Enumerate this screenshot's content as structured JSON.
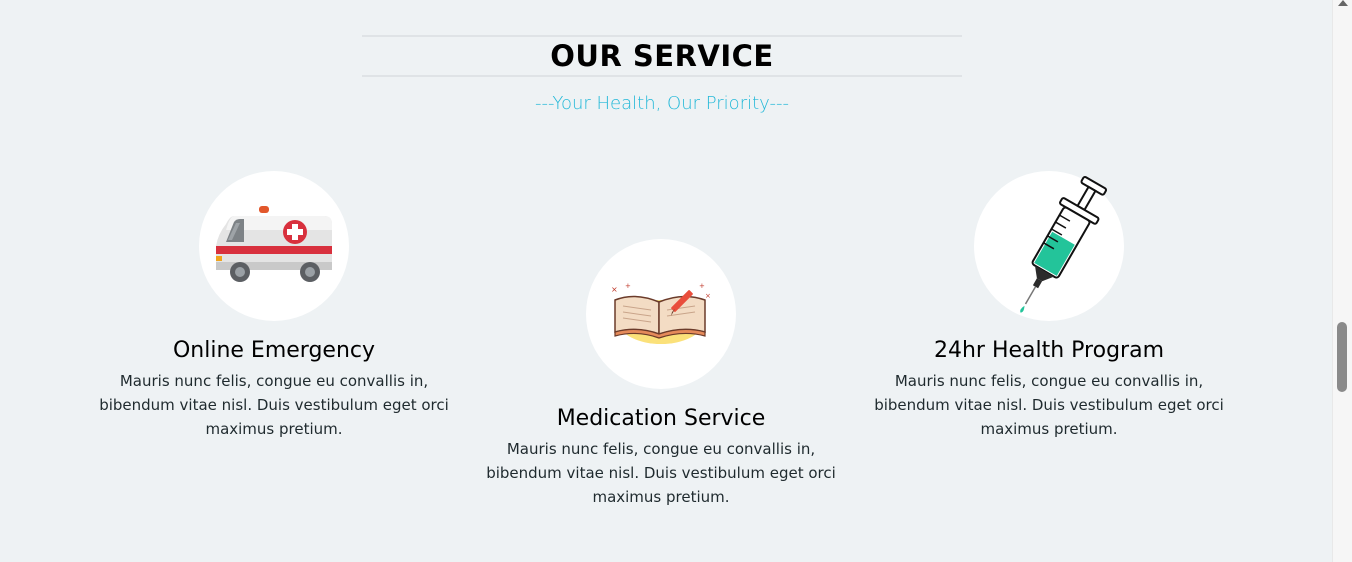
{
  "section": {
    "title": "OUR SERVICE",
    "subtitle": "---Your Health, Our Priority---"
  },
  "services": [
    {
      "icon": "ambulance-icon",
      "title": "Online Emergency",
      "description": "Mauris nunc felis, congue eu convallis in, bibendum vitae nisl. Duis vestibulum eget orci maximus pretium."
    },
    {
      "icon": "medical-book-icon",
      "title": "Medication Service",
      "description": "Mauris nunc felis, congue eu convallis in, bibendum vitae nisl. Duis vestibulum eget orci maximus pretium."
    },
    {
      "icon": "syringe-icon",
      "title": "24hr Health Program",
      "description": "Mauris nunc felis, congue eu convallis in, bibendum vitae nisl. Duis vestibulum eget orci maximus pretium."
    }
  ],
  "colors": {
    "background": "#eef2f4",
    "accent": "#22b8d8",
    "circle": "#ffffff"
  }
}
